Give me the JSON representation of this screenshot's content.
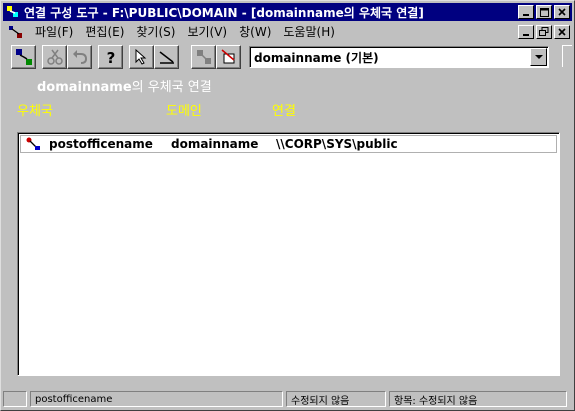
{
  "window": {
    "title": "연결 구성 도구 - F:\\PUBLIC\\DOMAIN - [domainname의 우체국 연결]"
  },
  "menu": {
    "items": [
      "파일(F)",
      "편집(E)",
      "찾기(S)",
      "보기(V)",
      "창(W)",
      "도움말(H)"
    ]
  },
  "toolbar": {
    "domain_select_value": "domainname (기본)"
  },
  "content": {
    "heading_bold": "domainname",
    "heading_rest": "의 우체국 연결",
    "columns": [
      "우체국",
      "도메인",
      "연결"
    ]
  },
  "rows": [
    {
      "postoffice": "postofficename",
      "domain": "domainname",
      "connection": "\\\\CORP\\SYS\\public"
    }
  ],
  "status": {
    "selected": "postofficename",
    "modified": "수정되지 않음",
    "items": "항목: 수정되지 않음"
  },
  "colors": {
    "titlebar": "#000080",
    "heading_text": "#ffffff",
    "column_header_text": "#ffff00",
    "background": "#c0c0c0"
  }
}
